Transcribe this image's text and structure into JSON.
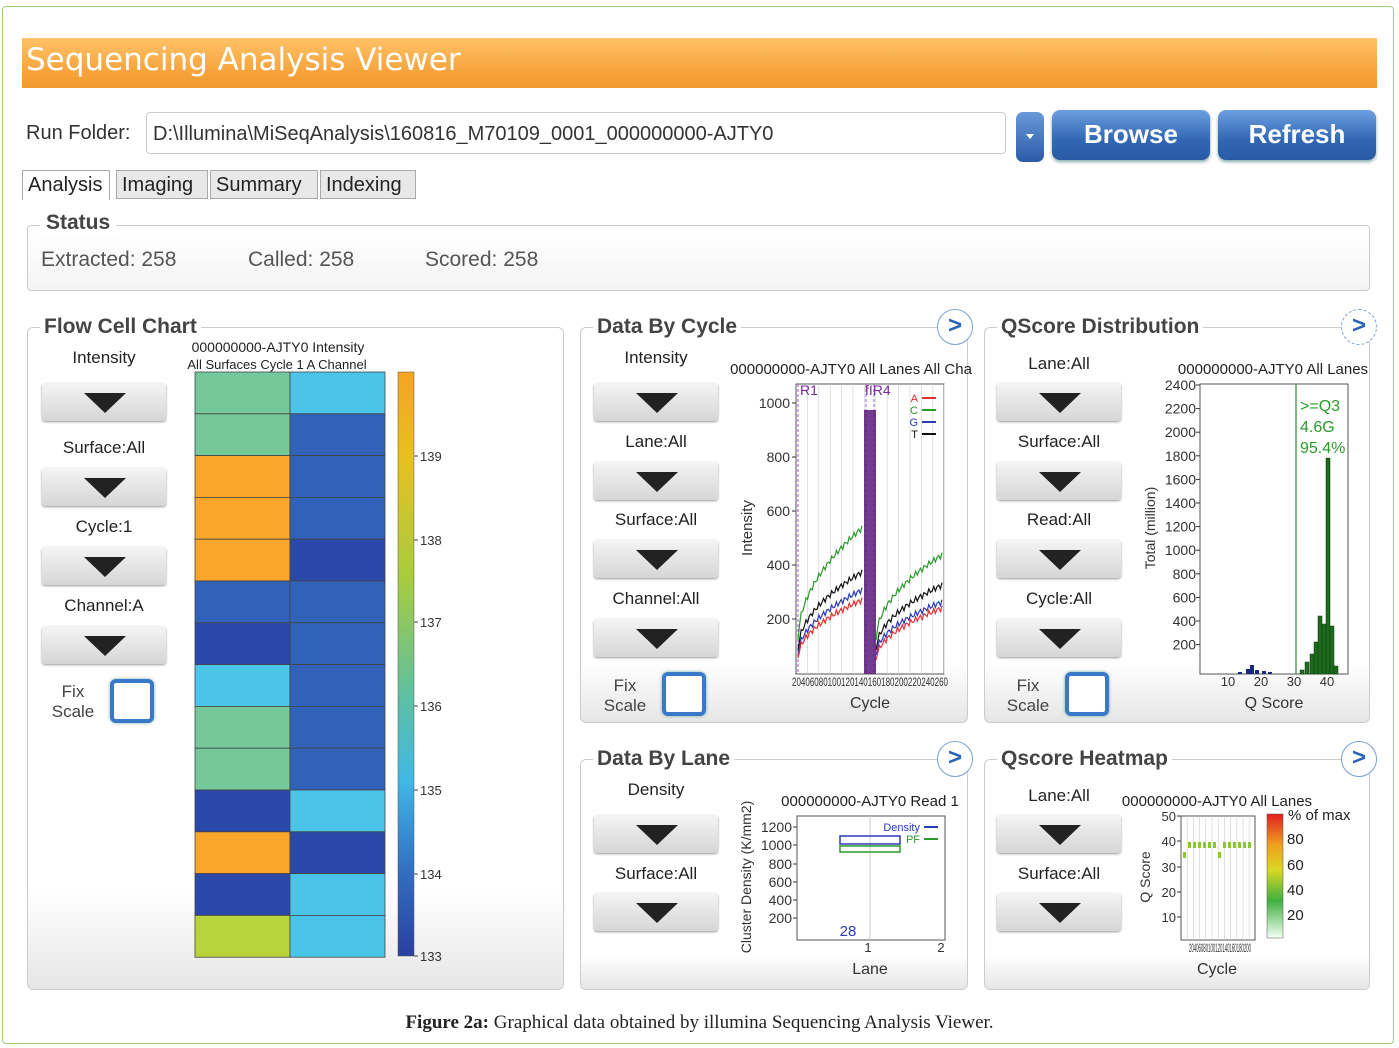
{
  "app": {
    "title": "Sequencing Analysis Viewer"
  },
  "runfolder": {
    "label": "Run Folder:",
    "path": "D:\\Illumina\\MiSeqAnalysis\\160816_M70109_0001_000000000-AJTY0",
    "browse": "Browse",
    "refresh": "Refresh"
  },
  "tabs": [
    "Analysis",
    "Imaging",
    "Summary",
    "Indexing"
  ],
  "status": {
    "title": "Status",
    "extracted": "Extracted: 258",
    "called": "Called: 258",
    "scored": "Scored: 258"
  },
  "fix_scale": {
    "fix": "Fix",
    "scale": "Scale"
  },
  "flowcell": {
    "title": "Flow Cell Chart",
    "controls": [
      "Intensity",
      "Surface:All",
      "Cycle:1",
      "Channel:A"
    ],
    "chart_title1": "000000000-AJTY0 Intensity",
    "chart_title2": "All Surfaces Cycle 1 A Channel",
    "colors": {
      "orange": "#f9a62a",
      "green": "#74c89a",
      "lightblue": "#4ac4e8",
      "blue": "#2f62b8",
      "darkblue": "#2a48a8",
      "lime": "#b8d43a"
    },
    "grid": [
      [
        "green",
        "lightblue"
      ],
      [
        "green",
        "blue"
      ],
      [
        "orange",
        "blue"
      ],
      [
        "orange",
        "blue"
      ],
      [
        "orange",
        "darkblue"
      ],
      [
        "blue",
        "blue"
      ],
      [
        "darkblue",
        "blue"
      ],
      [
        "lightblue",
        "blue"
      ],
      [
        "green",
        "blue"
      ],
      [
        "green",
        "blue"
      ],
      [
        "darkblue",
        "lightblue"
      ],
      [
        "orange",
        "darkblue"
      ],
      [
        "darkblue",
        "lightblue"
      ],
      [
        "lime",
        "lightblue"
      ]
    ],
    "scale_ticks": [
      "139",
      "138",
      "137",
      "136",
      "135",
      "134",
      "133"
    ]
  },
  "data_by_cycle": {
    "title": "Data By Cycle",
    "controls": [
      "Intensity",
      "Lane:All",
      "Surface:All",
      "Channel:All"
    ],
    "chart_title": "000000000-AJTY0 All Lanes All Cha",
    "ylabel": "Intensity",
    "xlabel": "Cycle",
    "y_ticks": [
      "1000",
      "800",
      "600",
      "400",
      "200"
    ],
    "x_ticks": [
      "20",
      "40",
      "60",
      "80",
      "100",
      "120",
      "140",
      "160",
      "180",
      "200",
      "220",
      "240",
      "260"
    ],
    "markers": [
      "R1",
      "fIR4"
    ],
    "legend": [
      {
        "name": "A",
        "color": "#e03030"
      },
      {
        "name": "C",
        "color": "#2a9a2a"
      },
      {
        "name": "G",
        "color": "#2a3ab8"
      },
      {
        "name": "T",
        "color": "#111111"
      }
    ]
  },
  "qscore_dist": {
    "title": "QScore Distribution",
    "controls": [
      "Lane:All",
      "Surface:All",
      "Read:All",
      "Cycle:All"
    ],
    "chart_title": "000000000-AJTY0 All Lanes",
    "ylabel": "Total (million)",
    "xlabel": "Q Score",
    "y_ticks": [
      "2400",
      "2200",
      "2000",
      "1800",
      "1600",
      "1400",
      "1200",
      "1000",
      "800",
      "600",
      "400",
      "200"
    ],
    "x_ticks": [
      "10",
      "20",
      "30",
      "40"
    ],
    "annotation": [
      ">=Q3",
      "4.6G",
      "95.4%"
    ]
  },
  "data_by_lane": {
    "title": "Data By Lane",
    "controls": [
      "Density",
      "Surface:All"
    ],
    "chart_title": "000000000-AJTY0 Read 1",
    "ylabel": "Cluster Density (K/mm2)",
    "xlabel": "Lane",
    "y_ticks": [
      "1200",
      "1000",
      "800",
      "600",
      "400",
      "200"
    ],
    "x_ticks": [
      "1",
      "2"
    ],
    "count_label": "28",
    "legend": [
      {
        "name": "Density",
        "color": "#2a3ab8"
      },
      {
        "name": "PF",
        "color": "#2a9a2a"
      }
    ]
  },
  "qscore_heatmap": {
    "title": "Qscore Heatmap",
    "controls": [
      "Lane:All",
      "Surface:All"
    ],
    "chart_title": "000000000-AJTY0 All Lanes",
    "ylabel": "Q Score",
    "xlabel": "Cycle",
    "y_ticks": [
      "50",
      "40",
      "30",
      "20",
      "10"
    ],
    "x_tick_text": "20406080100120140160180200",
    "colorbar_title": "% of max",
    "colorbar_ticks": [
      "80",
      "60",
      "40",
      "20"
    ]
  },
  "caption": {
    "label": "Figure 2a:",
    "text": "Graphical data obtained by illumina Sequencing Analysis Viewer."
  }
}
